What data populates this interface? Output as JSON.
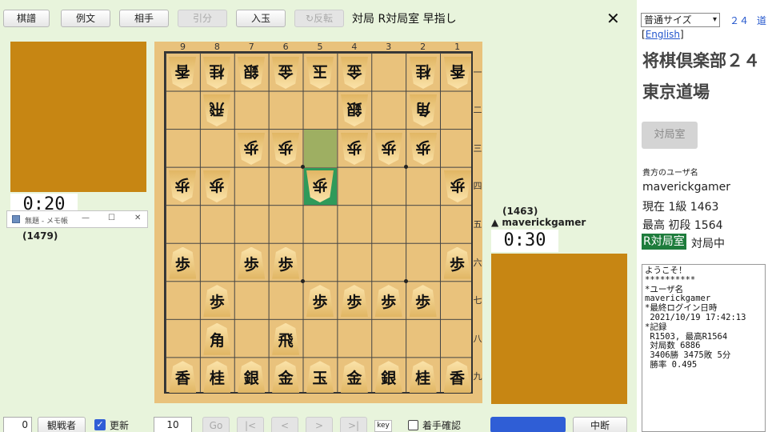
{
  "toolbar": {
    "kifu": "棋譜",
    "reibun": "例文",
    "aite": "相手",
    "hikiwake": "引分",
    "nyugyoku": "入玉",
    "hanten": "↻反転",
    "title": "対局 R対局室 早指し",
    "close": "✕"
  },
  "players": {
    "top": {
      "clock": "0:20",
      "rating": "(1479)"
    },
    "bottom": {
      "rating": "(1463)",
      "name": "▲ maverickgamer",
      "clock": "0:30"
    }
  },
  "notepad": {
    "title": "無題 - メモ帳",
    "min": "—",
    "max": "☐",
    "close": "✕"
  },
  "board": {
    "files": [
      "9",
      "8",
      "7",
      "6",
      "5",
      "4",
      "3",
      "2",
      "1"
    ],
    "ranks": [
      "一",
      "二",
      "三",
      "四",
      "五",
      "六",
      "七",
      "八",
      "九"
    ],
    "pieces": [
      {
        "f": 9,
        "r": 1,
        "k": "香",
        "g": true
      },
      {
        "f": 8,
        "r": 1,
        "k": "桂",
        "g": true
      },
      {
        "f": 7,
        "r": 1,
        "k": "銀",
        "g": true
      },
      {
        "f": 6,
        "r": 1,
        "k": "金",
        "g": true
      },
      {
        "f": 5,
        "r": 1,
        "k": "玉",
        "g": true
      },
      {
        "f": 4,
        "r": 1,
        "k": "金",
        "g": true
      },
      {
        "f": 2,
        "r": 1,
        "k": "桂",
        "g": true
      },
      {
        "f": 1,
        "r": 1,
        "k": "香",
        "g": true
      },
      {
        "f": 8,
        "r": 2,
        "k": "飛",
        "g": true
      },
      {
        "f": 4,
        "r": 2,
        "k": "銀",
        "g": true
      },
      {
        "f": 2,
        "r": 2,
        "k": "角",
        "g": true
      },
      {
        "f": 7,
        "r": 3,
        "k": "歩",
        "g": true
      },
      {
        "f": 6,
        "r": 3,
        "k": "歩",
        "g": true
      },
      {
        "f": 4,
        "r": 3,
        "k": "歩",
        "g": true
      },
      {
        "f": 3,
        "r": 3,
        "k": "歩",
        "g": true
      },
      {
        "f": 2,
        "r": 3,
        "k": "歩",
        "g": true
      },
      {
        "f": 9,
        "r": 4,
        "k": "歩",
        "g": true
      },
      {
        "f": 8,
        "r": 4,
        "k": "歩",
        "g": true
      },
      {
        "f": 5,
        "r": 4,
        "k": "歩",
        "g": true
      },
      {
        "f": 1,
        "r": 4,
        "k": "歩",
        "g": true
      },
      {
        "f": 9,
        "r": 6,
        "k": "歩",
        "g": false
      },
      {
        "f": 7,
        "r": 6,
        "k": "歩",
        "g": false
      },
      {
        "f": 6,
        "r": 6,
        "k": "歩",
        "g": false
      },
      {
        "f": 1,
        "r": 6,
        "k": "歩",
        "g": false
      },
      {
        "f": 8,
        "r": 7,
        "k": "歩",
        "g": false
      },
      {
        "f": 5,
        "r": 7,
        "k": "歩",
        "g": false
      },
      {
        "f": 4,
        "r": 7,
        "k": "歩",
        "g": false
      },
      {
        "f": 3,
        "r": 7,
        "k": "歩",
        "g": false
      },
      {
        "f": 2,
        "r": 7,
        "k": "歩",
        "g": false
      },
      {
        "f": 8,
        "r": 8,
        "k": "角",
        "g": false
      },
      {
        "f": 6,
        "r": 8,
        "k": "飛",
        "g": false
      },
      {
        "f": 9,
        "r": 9,
        "k": "香",
        "g": false
      },
      {
        "f": 8,
        "r": 9,
        "k": "桂",
        "g": false
      },
      {
        "f": 7,
        "r": 9,
        "k": "銀",
        "g": false
      },
      {
        "f": 6,
        "r": 9,
        "k": "金",
        "g": false
      },
      {
        "f": 5,
        "r": 9,
        "k": "玉",
        "g": false
      },
      {
        "f": 4,
        "r": 9,
        "k": "金",
        "g": false
      },
      {
        "f": 3,
        "r": 9,
        "k": "銀",
        "g": false
      },
      {
        "f": 2,
        "r": 9,
        "k": "桂",
        "g": false
      },
      {
        "f": 1,
        "r": 9,
        "k": "香",
        "g": false
      }
    ],
    "last_move_from": {
      "f": 5,
      "r": 3,
      "color": "#9eaf62"
    },
    "last_move_to": {
      "f": 5,
      "r": 4,
      "color": "#2f9a5a"
    }
  },
  "bottom_bar": {
    "move_num": "0",
    "kansen": "観戦者",
    "koshin": "更新",
    "koshin_checked": true,
    "step": "10",
    "go": "Go",
    "first": "|<",
    "prev": "<",
    "next": ">",
    "last": ">|",
    "key": "key",
    "chakushu": "着手確認",
    "chudan": "中断"
  },
  "right": {
    "size_select": "普通サイズ",
    "link_24": "２４",
    "link_dojo": "道",
    "english": "English",
    "club": "将棋倶楽部２４",
    "dojo": "東京道場",
    "room_button": "対局室",
    "user_label": "貴方のユーザ名",
    "username": "maverickgamer",
    "current": "現在 1級 1463",
    "best": "最高 初段 1564",
    "room_badge": "R対局室",
    "status": "対局中",
    "messages": "ようこそ！\n**********\n*ユーザ名\nmaverickgamer\n*最終ログイン日時\n 2021/10/19 17:42:13\n*記録\n R1503, 最高R1564\n 対局数 6886\n 3406勝 3475敗 5分\n 勝率 0.495"
  },
  "colors": {
    "background": "#e8f4dc",
    "stand": "#c78613",
    "board": "#e9c27c",
    "badge": "#1e7c3c",
    "button_blue": "#2f5ed6"
  }
}
